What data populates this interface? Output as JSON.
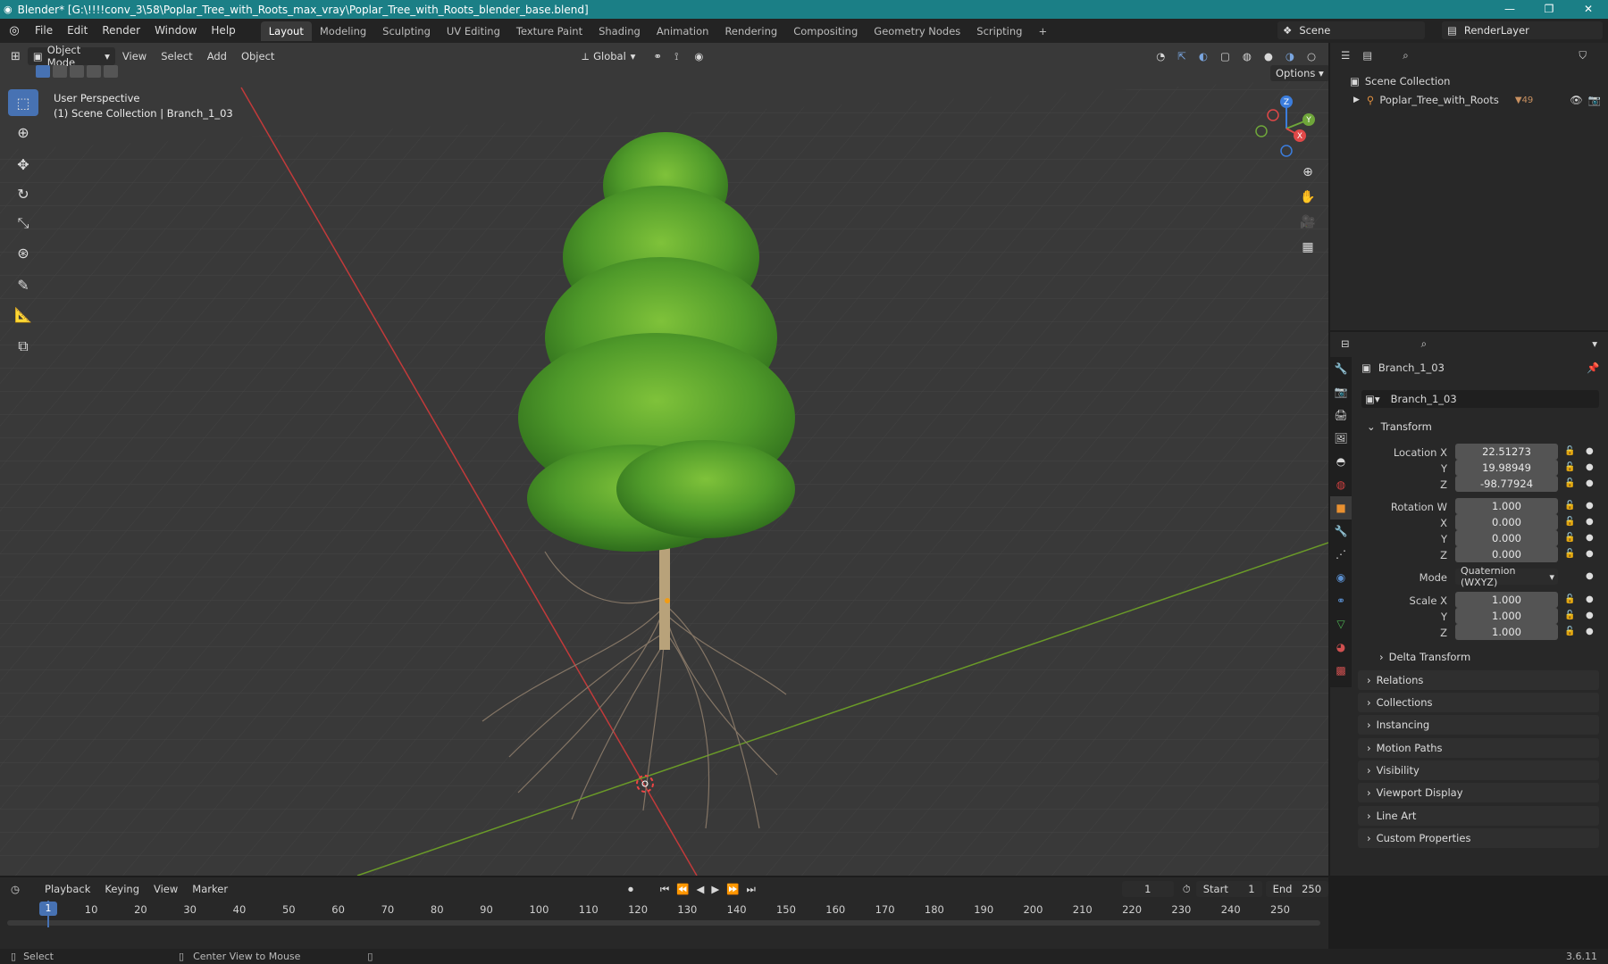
{
  "window": {
    "title": "Blender* [G:\\!!!!conv_3\\58\\Poplar_Tree_with_Roots_max_vray\\Poplar_Tree_with_Roots_blender_base.blend]",
    "controls": [
      "—",
      "❐",
      "✕"
    ]
  },
  "menus": [
    "File",
    "Edit",
    "Render",
    "Window",
    "Help"
  ],
  "workspaces": [
    "Layout",
    "Modeling",
    "Sculpting",
    "UV Editing",
    "Texture Paint",
    "Shading",
    "Animation",
    "Rendering",
    "Compositing",
    "Geometry Nodes",
    "Scripting",
    "+"
  ],
  "active_workspace": "Layout",
  "scene": {
    "label": "Scene",
    "render_layer": "RenderLayer"
  },
  "viewport": {
    "mode": "Object Mode",
    "header_menus": [
      "View",
      "Select",
      "Add",
      "Object"
    ],
    "orientation": "Global",
    "options": "Options",
    "perspective": "User Perspective",
    "context": "(1) Scene Collection | Branch_1_03",
    "gizmo": {
      "x": "X",
      "y": "Y",
      "z": "Z"
    }
  },
  "tools": [
    "select-box-icon",
    "cursor-icon",
    "move-icon",
    "rotate-icon",
    "scale-icon",
    "transform-icon",
    "annotate-icon",
    "measure-icon",
    "add-cube-icon"
  ],
  "outliner": {
    "scene_collection": "Scene Collection",
    "items": [
      {
        "name": "Poplar_Tree_with_Roots",
        "badge": "49"
      }
    ]
  },
  "properties": {
    "object_name": "Branch_1_03",
    "datablock": "Branch_1_03",
    "transform_label": "Transform",
    "location": {
      "label": "Location X",
      "x": "22.51273",
      "y": "19.98949",
      "z": "-98.77924"
    },
    "rotation": {
      "label": "Rotation W",
      "w": "1.000",
      "x": "0.000",
      "y": "0.000",
      "z": "0.000"
    },
    "mode_label": "Mode",
    "mode": "Quaternion (WXYZ)",
    "scale": {
      "label": "Scale X",
      "x": "1.000",
      "y": "1.000",
      "z": "1.000"
    },
    "axis": {
      "x": "X",
      "y": "Y",
      "z": "Z"
    },
    "panels": [
      "Delta Transform",
      "Relations",
      "Collections",
      "Instancing",
      "Motion Paths",
      "Visibility",
      "Viewport Display",
      "Line Art",
      "Custom Properties"
    ]
  },
  "timeline": {
    "menus": [
      "Playback",
      "Keying",
      "View",
      "Marker"
    ],
    "current": "1",
    "start_label": "Start",
    "start": "1",
    "end_label": "End",
    "end": "250",
    "ticks": [
      "1",
      "10",
      "20",
      "30",
      "40",
      "50",
      "60",
      "70",
      "80",
      "90",
      "100",
      "110",
      "120",
      "130",
      "140",
      "150",
      "160",
      "170",
      "180",
      "190",
      "200",
      "210",
      "220",
      "230",
      "240",
      "250"
    ]
  },
  "status": {
    "select": "Select",
    "center": "Center View to Mouse",
    "version": "3.6.11"
  }
}
